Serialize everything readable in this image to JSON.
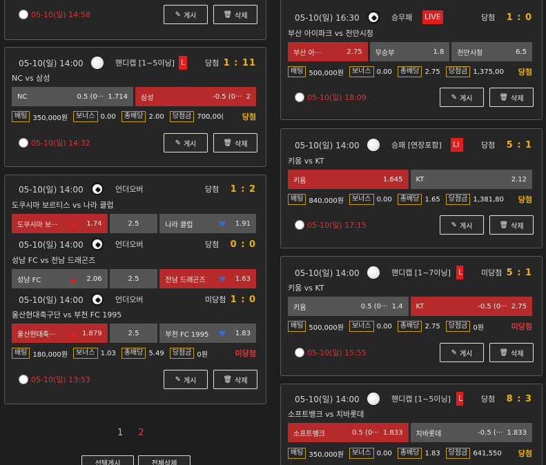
{
  "pagination": {
    "pages": [
      "1",
      "2"
    ]
  },
  "bottom_actions": {
    "select_post": "선택게시",
    "delete_all": "전체삭제"
  },
  "labels": {
    "bet": "배팅",
    "bonus": "보너스",
    "total_odds": "총배당",
    "payout": "당첨금",
    "post": "게시",
    "delete": "삭제"
  },
  "left": {
    "card0": {
      "footer_date": "05-10(일) 14:58"
    },
    "card1": {
      "date": "05-10(일) 14:00",
      "type": "핸디캡 [1~5이닝]",
      "live": "L",
      "result": "당첨",
      "score": "1 : 11",
      "teams": "NC vs 삼성",
      "odds": [
        {
          "name": "NC",
          "handicap": "0.5 (0···",
          "odd": "1.714",
          "selected": false
        },
        {
          "name": "삼성",
          "handicap": "-0.5 (0···",
          "odd": "2",
          "selected": true
        }
      ],
      "bet": "350,000원",
      "bonus": "0.00",
      "total_odds": "2.00",
      "payout": "700,00(",
      "status": "당첨",
      "footer_date": "05-10(일) 14:32"
    },
    "card2": {
      "matches": [
        {
          "date": "05-10(일) 14:00",
          "type": "언더오버",
          "result": "당첨",
          "score": "1 : 2",
          "teams": "도쿠시마 보르티스 vs 나라 클럽",
          "odds": [
            {
              "name": "도쿠시마 보···",
              "odd": "1.74",
              "selected": true
            },
            {
              "odd": "2.5"
            },
            {
              "name": "나라 클럽",
              "odd": "1.91",
              "selected": false
            }
          ]
        },
        {
          "date": "05-10(일) 14:00",
          "type": "언더오버",
          "result": "당첨",
          "score": "0 : 0",
          "teams": "성남 FC vs 전남 드래곤즈",
          "odds": [
            {
              "name": "성남 FC",
              "odd": "2.06",
              "selected": false
            },
            {
              "odd": "2.5"
            },
            {
              "name": "전남 드래곤즈",
              "odd": "1.63",
              "selected": true
            }
          ]
        },
        {
          "date": "05-10(일) 14:00",
          "type": "언더오버",
          "result": "미당첨",
          "score": "1 : 0",
          "teams": "울산현대축구단 vs 부천 FC 1995",
          "odds": [
            {
              "name": "울산현대축···",
              "odd": "1.879",
              "selected": true
            },
            {
              "odd": "2.5"
            },
            {
              "name": "부천 FC 1995",
              "odd": "1.83",
              "selected": false
            }
          ]
        }
      ],
      "bet": "180,000원",
      "bonus": "1.03",
      "total_odds": "5.49",
      "payout": "0원",
      "status": "미당첨",
      "footer_date": "05-10(일) 13:53"
    }
  },
  "right": {
    "card1": {
      "date": "05-10(일) 16:30",
      "type": "승무패",
      "live": "LIVE",
      "result": "당첨",
      "score": "1 : 0",
      "teams": "부산 아이파크 vs 천안시청",
      "odds": [
        {
          "name": "부산 아···",
          "odd": "2.75",
          "selected": true
        },
        {
          "name": "무승부",
          "odd": "1.8",
          "selected": false
        },
        {
          "name": "천안시청",
          "odd": "6.5",
          "selected": false
        }
      ],
      "bet": "500,000원",
      "bonus": "0.00",
      "total_odds": "2.75",
      "payout": "1,375,00",
      "status": "당첨",
      "footer_date": "05-10(일) 18:09"
    },
    "card2": {
      "date": "05-10(일) 14:00",
      "type": "승패 [연장포함]",
      "live": "LI",
      "result": "당첨",
      "score": "5 : 1",
      "teams": "키움 vs KT",
      "odds": [
        {
          "name": "키움",
          "odd": "1.645",
          "selected": true
        },
        {
          "name": "KT",
          "odd": "2.12",
          "selected": false
        }
      ],
      "bet": "840,000원",
      "bonus": "0.00",
      "total_odds": "1.65",
      "payout": "1,381,80",
      "status": "당첨",
      "footer_date": "05-10(일) 17:15"
    },
    "card3": {
      "date": "05-10(일) 14:00",
      "type": "핸디캡 [1~7이닝]",
      "live": "L",
      "result": "미당첨",
      "score": "5 : 1",
      "teams": "키움 vs KT",
      "odds": [
        {
          "name": "키움",
          "handicap": "0.5 (0···",
          "odd": "1.4",
          "selected": false
        },
        {
          "name": "KT",
          "handicap": "-0.5 (0···",
          "odd": "2.75",
          "selected": true
        }
      ],
      "bet": "500,000원",
      "bonus": "0.00",
      "total_odds": "2.75",
      "payout": "0원",
      "status": "미당첨",
      "footer_date": "05-10(일) 15:55"
    },
    "card4": {
      "date": "05-10(일) 14:00",
      "type": "핸디캡 [1~5이닝]",
      "live": "L",
      "result": "당첨",
      "score": "8 : 3",
      "teams": "소프트뱅크 vs 치바롯데",
      "odds": [
        {
          "name": "소프트뱅크",
          "handicap": "0.5 (0···",
          "odd": "1.833",
          "selected": true
        },
        {
          "name": "치바롯데",
          "handicap": "-0.5 (···",
          "odd": "1.833",
          "selected": false
        }
      ],
      "bet": "350,000원",
      "bonus": "0.00",
      "total_odds": "1.83",
      "payout": "641,550",
      "status": "당첨"
    }
  }
}
